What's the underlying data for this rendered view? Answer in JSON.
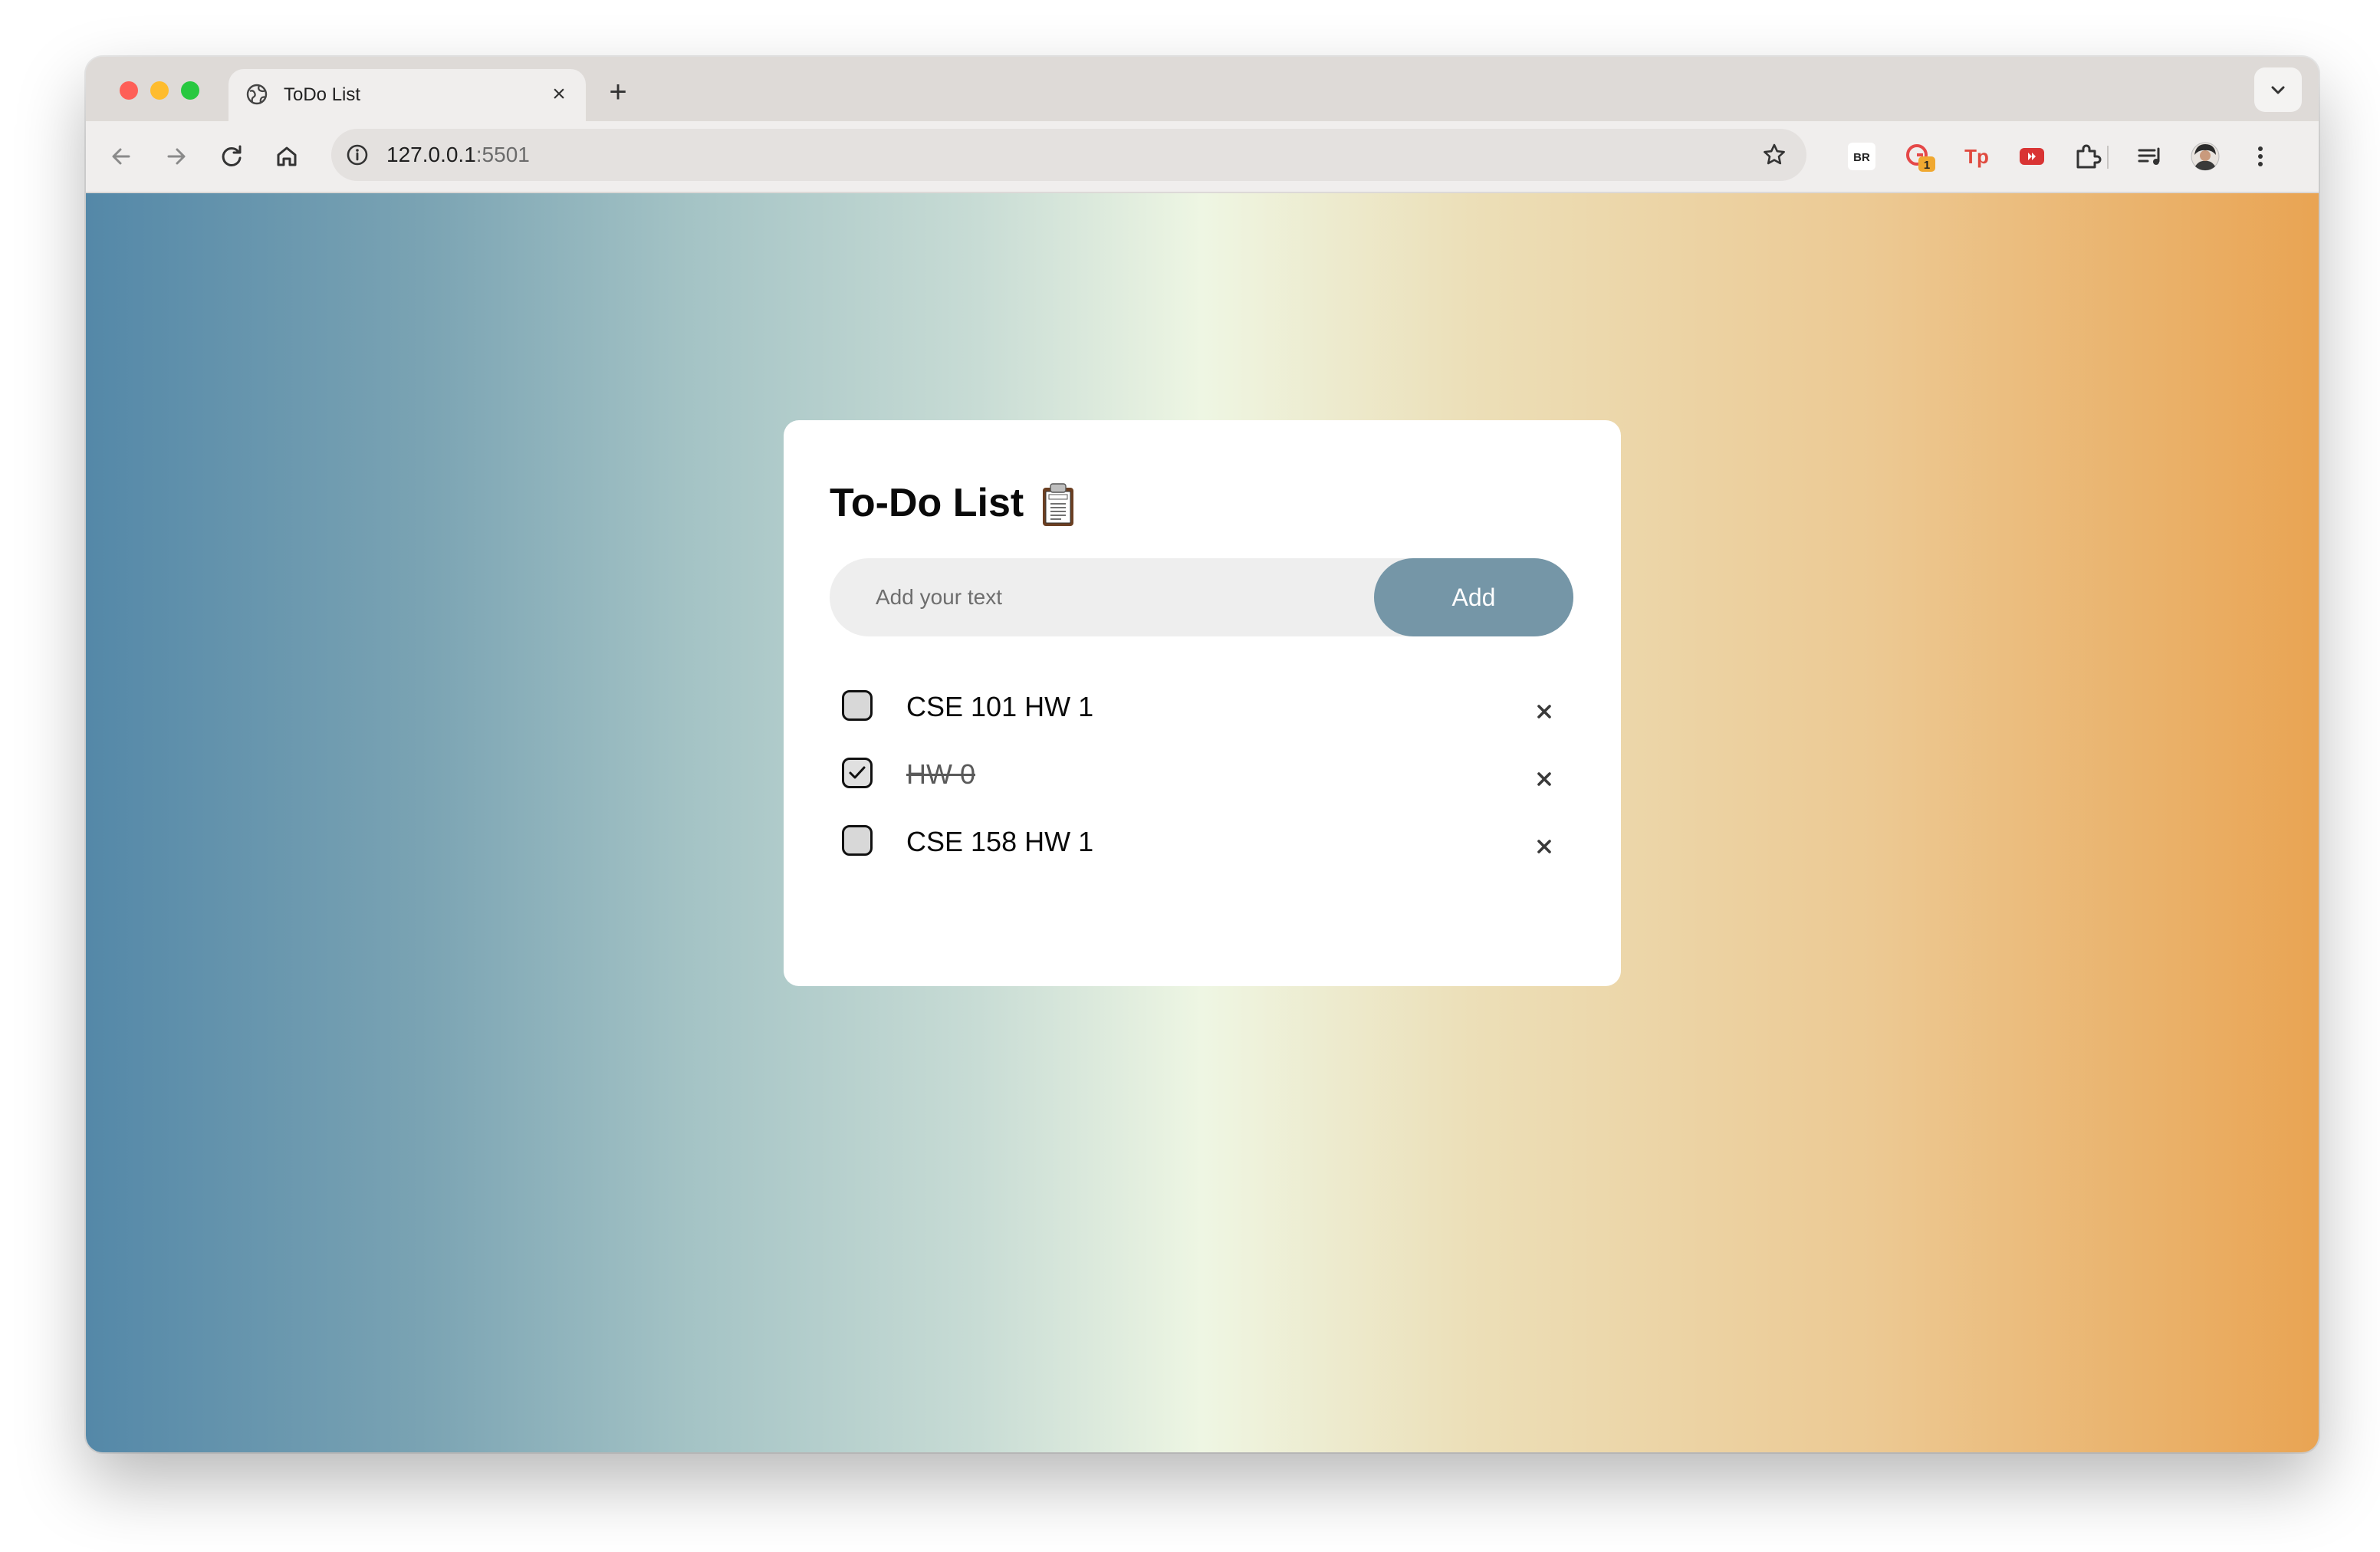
{
  "browser": {
    "tab": {
      "title": "ToDo List",
      "close_label": "×"
    },
    "new_tab_label": "+",
    "address": {
      "host": "127.0.0.1",
      "port": ":5501"
    },
    "extensions": [
      {
        "icon": "br-extension-icon",
        "label": "BR"
      },
      {
        "icon": "grammar-extension-icon",
        "badge": "1"
      },
      {
        "icon": "tp-extension-icon",
        "label": "Tp"
      },
      {
        "icon": "video-extension-icon"
      },
      {
        "icon": "puzzle-extensions-icon"
      },
      {
        "icon": "reading-list-icon"
      },
      {
        "icon": "profile-avatar"
      },
      {
        "icon": "kebab-menu-icon"
      }
    ]
  },
  "app": {
    "title": "To-Do List",
    "title_icon": "clipboard-icon",
    "input_placeholder": "Add your text",
    "input_value": "",
    "add_label": "Add",
    "accent_color": "#7596a7",
    "tasks": [
      {
        "text": "CSE 101 HW 1",
        "done": false
      },
      {
        "text": "HW 0",
        "done": true
      },
      {
        "text": "CSE 158 HW 1",
        "done": false
      }
    ]
  }
}
